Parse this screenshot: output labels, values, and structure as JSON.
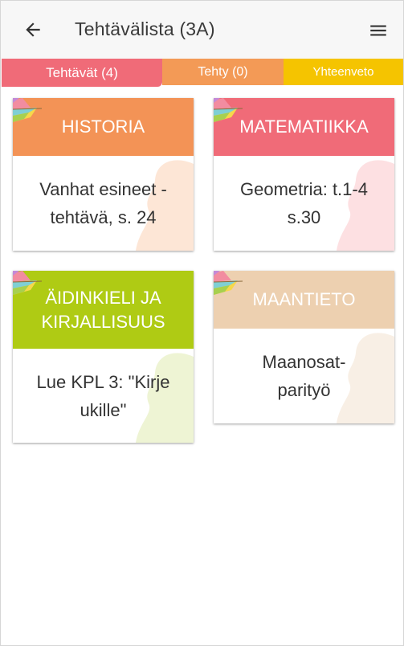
{
  "header": {
    "back_icon": "arrow-left-icon",
    "title": "Tehtävälista (3A)",
    "menu_icon": "hamburger-menu-icon"
  },
  "tabs": [
    {
      "label": "Tehtävät (4)",
      "color": "#f06b78",
      "selected": true
    },
    {
      "label": "Tehty (0)",
      "color": "#f39a56",
      "selected": false
    },
    {
      "label": "Yhteenveto",
      "color": "#f5c400",
      "selected": false
    }
  ],
  "cards": [
    {
      "subject": "HISTORIA",
      "task": "Vanhat esineet - tehtävä, s. 24",
      "header_color": "#f39356",
      "blob_color": "#fde6d6"
    },
    {
      "subject": "MATEMATIIKKA",
      "task": "Geometria: t.1-4 s.30",
      "header_color": "#f06b78",
      "blob_color": "#fde0e2"
    },
    {
      "subject": "ÄIDINKIELI JA KIRJALLISUUS",
      "task": "Lue KPL 3: \"Kirje ukille\"",
      "header_color": "#afcb14",
      "blob_color": "#eef4d4"
    },
    {
      "subject": "MAANTIETO",
      "task": "Maanosat-parityö",
      "header_color": "#edd0b0",
      "blob_color": "#f8efe5"
    }
  ]
}
